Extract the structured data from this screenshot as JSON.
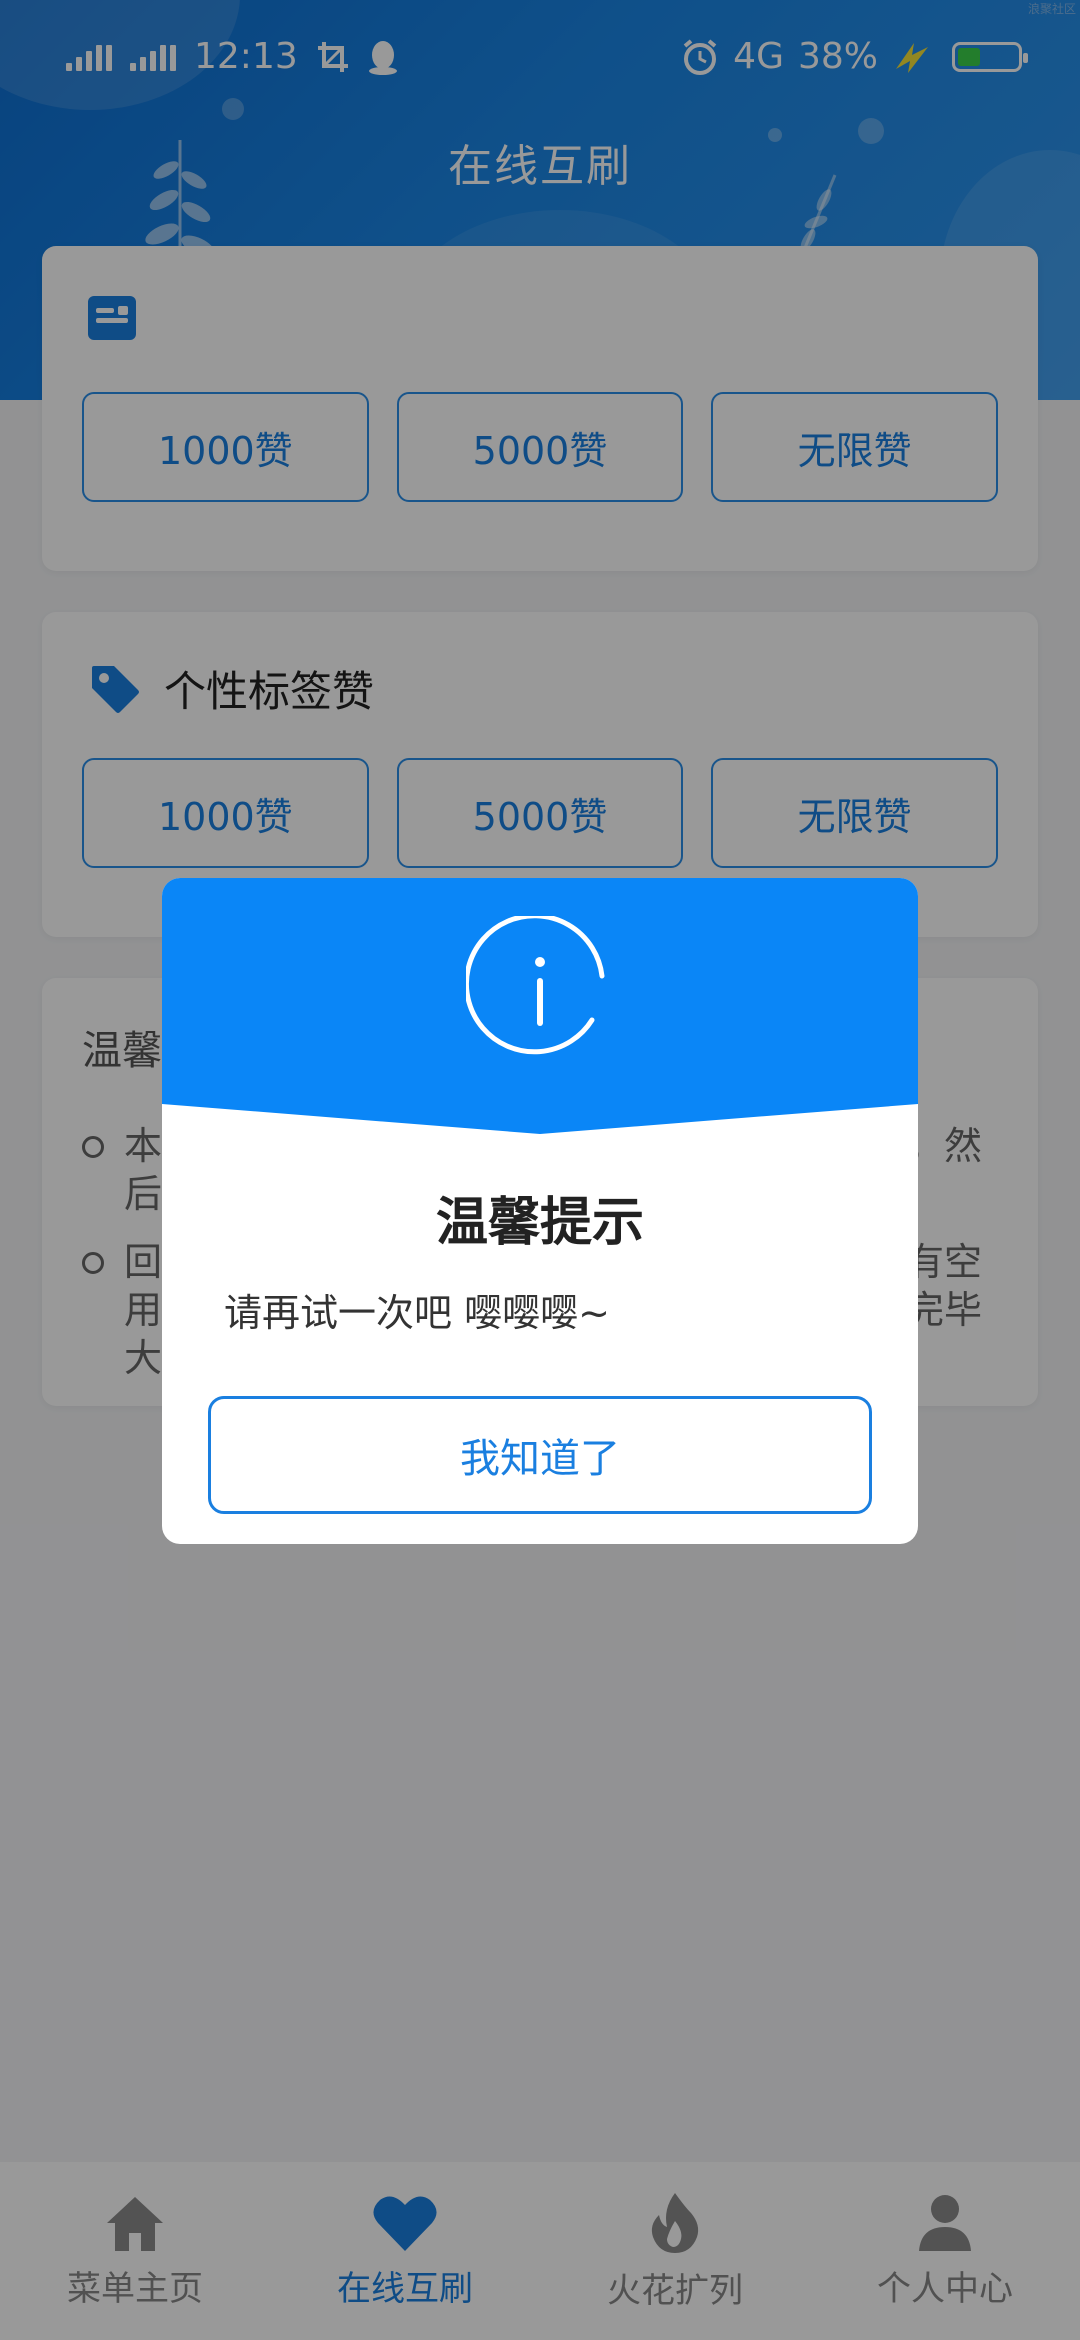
{
  "status_bar": {
    "time": "12:13",
    "network": "4G",
    "battery_percent": "38%",
    "battery_level": 0.38,
    "icons": [
      "signal-icon",
      "signal-icon",
      "screenshot-icon",
      "qq-penguin-icon",
      "alarm-icon",
      "charging-bolt-icon",
      "battery-icon"
    ]
  },
  "corner_mark": "浪聚社区",
  "header": {
    "title": "在线互刷"
  },
  "card1": {
    "icon": "id-card-icon",
    "title": "",
    "buttons": [
      "1000赞",
      "5000赞",
      "无限赞"
    ]
  },
  "card2": {
    "icon": "tag-icon",
    "title": "个性标签赞",
    "buttons": [
      "1000赞",
      "5000赞",
      "无限赞"
    ]
  },
  "tips": {
    "title": "温馨",
    "items": [
      {
        "left": "本",
        "right": "，然",
        "left2": "后",
        "right2": ""
      },
      {
        "left": "回",
        "right": "有空",
        "left2": "用",
        "right2": "完毕",
        "left3": "大"
      }
    ]
  },
  "dialog": {
    "icon": "info-icon",
    "title": "温馨提示",
    "message": "请再试一次吧 嘤嘤嘤~",
    "button": "我知道了",
    "colors": {
      "banner": "#0a86f7",
      "accent": "#1a7fe0"
    }
  },
  "bottom_nav": {
    "items": [
      {
        "label": "菜单主页",
        "icon": "home-icon",
        "active": false
      },
      {
        "label": "在线互刷",
        "icon": "heart-icon",
        "active": true
      },
      {
        "label": "火花扩列",
        "icon": "flame-icon",
        "active": false
      },
      {
        "label": "个人中心",
        "icon": "person-icon",
        "active": false
      }
    ]
  }
}
